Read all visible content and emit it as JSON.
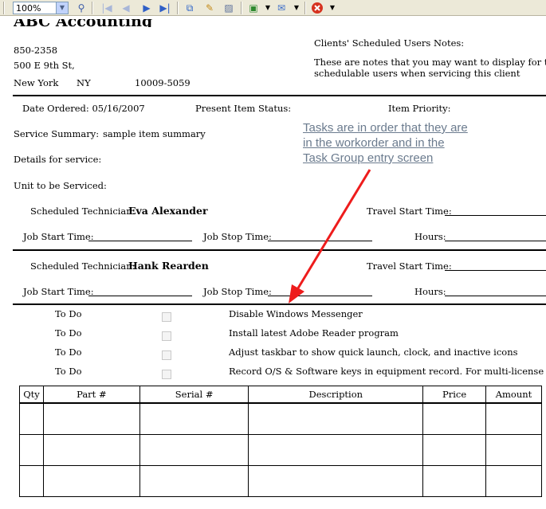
{
  "toolbar": {
    "zoom": "100%",
    "icons": [
      "dropdown-arrow-icon",
      "zoom-icon",
      "first-page-icon",
      "prev-page-icon",
      "next-page-icon",
      "last-page-icon",
      "page-setup-icon",
      "find-icon",
      "print-preview-icon",
      "export-icon",
      "email-icon",
      "close-icon"
    ]
  },
  "company": {
    "name_partial": "ABC Accounting",
    "phone": "850-2358",
    "address": "500 E 9th St,",
    "city": "New York",
    "state": "NY",
    "zip": "10009-5059"
  },
  "client_notes": {
    "heading": "Clients' Scheduled Users Notes:",
    "line1": "These are notes that you may want to display for the",
    "line2": "schedulable users when servicing this client"
  },
  "order": {
    "date_ordered": "Date Ordered: 05/16/2007",
    "present_item_status": "Present Item Status:",
    "item_priority": "Item Priority:",
    "service_summary_label": "Service Summary:",
    "service_summary_value": "sample item summary",
    "details_label": "Details for service:",
    "unit_label": "Unit to be Serviced:"
  },
  "technicians": [
    {
      "label": "Scheduled Technician:",
      "name": "Eva Alexander",
      "travel": "Travel Start Time:",
      "job_start": "Job Start Time:",
      "job_stop": "Job Stop Time:",
      "hours": "Hours:"
    },
    {
      "label": "Scheduled Technician:",
      "name": "Hank Rearden",
      "travel": "Travel Start Time:",
      "job_start": "Job Start Time:",
      "job_stop": "Job Stop Time:",
      "hours": "Hours:"
    }
  ],
  "annotation": {
    "line1": "Tasks are in order that they are",
    "line2": "in the workorder and in the",
    "line3": "Task Group entry screen",
    "arrow_color": "#ee1c1c"
  },
  "tasks": [
    {
      "status": "To Do",
      "description": "Disable Windows Messenger"
    },
    {
      "status": "To Do",
      "description": "Install latest Adobe Reader program"
    },
    {
      "status": "To Do",
      "description": "Adjust taskbar to show quick launch, clock, and inactive icons"
    },
    {
      "status": "To Do",
      "description": "Record O/S & Software keys in equipment record. For multi-license key"
    }
  ],
  "parts_table": {
    "headers": [
      "Qty",
      "Part #",
      "Serial #",
      "Description",
      "Price",
      "Amount"
    ]
  }
}
